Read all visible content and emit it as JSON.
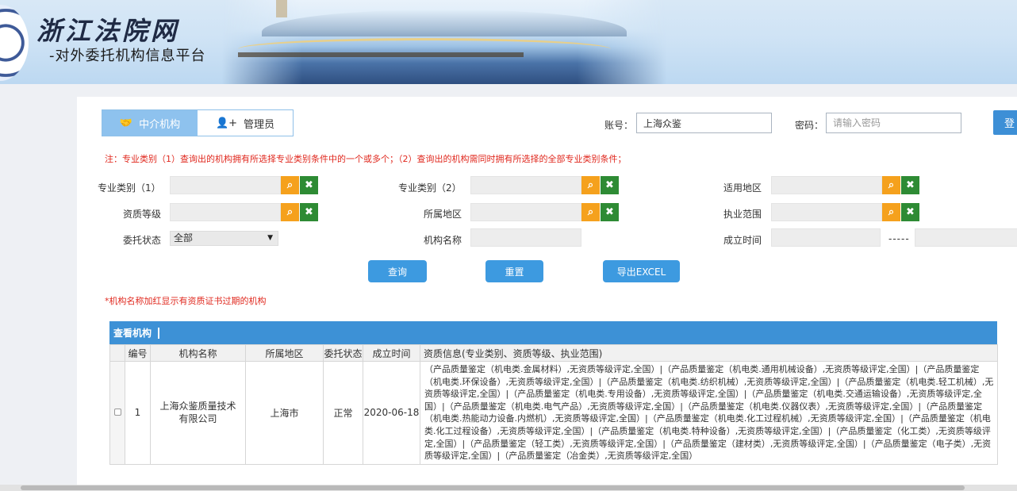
{
  "header": {
    "title": "浙江法院网",
    "subtitle": "-对外委托机构信息平台"
  },
  "tabs": [
    {
      "label": "中介机构",
      "icon": "handshake-icon",
      "active": true
    },
    {
      "label": "管理员",
      "icon": "add-user-icon",
      "active": false
    }
  ],
  "login": {
    "account_label": "账号：",
    "account_value": "上海众鉴",
    "password_label": "密码：",
    "password_placeholder": "请输入密码",
    "login_button": "登"
  },
  "note": "注：专业类别（1）查询出的机构拥有所选择专业类别条件中的一个或多个；（2）查询出的机构需同时拥有所选择的全部专业类别条件；",
  "filters": {
    "category1": "专业类别（1）",
    "category2": "专业类别（2）",
    "region_applicable": "适用地区",
    "qualification_level": "资质等级",
    "located_region": "所属地区",
    "practice_scope": "执业范围",
    "entrust_status": "委托状态",
    "entrust_status_value": "全部",
    "org_name": "机构名称",
    "established_time": "成立时间",
    "range_separator": "-----"
  },
  "actions": {
    "query": "查询",
    "reset": "重置",
    "export": "导出EXCEL"
  },
  "warning": "*机构名称加红显示有资质证书过期的机构",
  "list": {
    "title": "查看机构",
    "columns": [
      "编号",
      "机构名称",
      "所属地区",
      "委托状态",
      "成立时间",
      "资质信息(专业类别、资质等级、执业范围)"
    ],
    "rows": [
      {
        "no": "1",
        "name": "上海众鉴质量技术有限公司",
        "region": "上海市",
        "status": "正常",
        "date": "2020-06-18",
        "qualifications": "（产品质量鉴定（机电类.金属材料）,无资质等级评定,全国）|（产品质量鉴定（机电类.通用机械设备）,无资质等级评定,全国）|（产品质量鉴定（机电类.环保设备）,无资质等级评定,全国）|（产品质量鉴定（机电类.纺织机械）,无资质等级评定,全国）|（产品质量鉴定（机电类.轻工机械）,无资质等级评定,全国）|（产品质量鉴定（机电类.专用设备）,无资质等级评定,全国）|（产品质量鉴定（机电类.交通运输设备）,无资质等级评定,全国）|（产品质量鉴定（机电类.电气产品）,无资质等级评定,全国）|（产品质量鉴定（机电类.仪器仪表）,无资质等级评定,全国）|（产品质量鉴定（机电类.热能动力设备.内燃机）,无资质等级评定,全国）|（产品质量鉴定（机电类.化工过程机械）,无资质等级评定,全国）|（产品质量鉴定（机电类.化工过程设备）,无资质等级评定,全国）|（产品质量鉴定（机电类.特种设备）,无资质等级评定,全国）|（产品质量鉴定（化工类）,无资质等级评定,全国）|（产品质量鉴定（轻工类）,无资质等级评定,全国）|（产品质量鉴定（建材类）,无资质等级评定,全国）|（产品质量鉴定（电子类）,无资质等级评定,全国）|（产品质量鉴定（冶金类）,无资质等级评定,全国）"
      }
    ]
  },
  "colors": {
    "accent": "#3d91d6",
    "tab_active": "#8ec2ee",
    "search_icon": "#f5a11d",
    "clear_icon": "#2e8b34",
    "note_red": "#e0281e"
  }
}
